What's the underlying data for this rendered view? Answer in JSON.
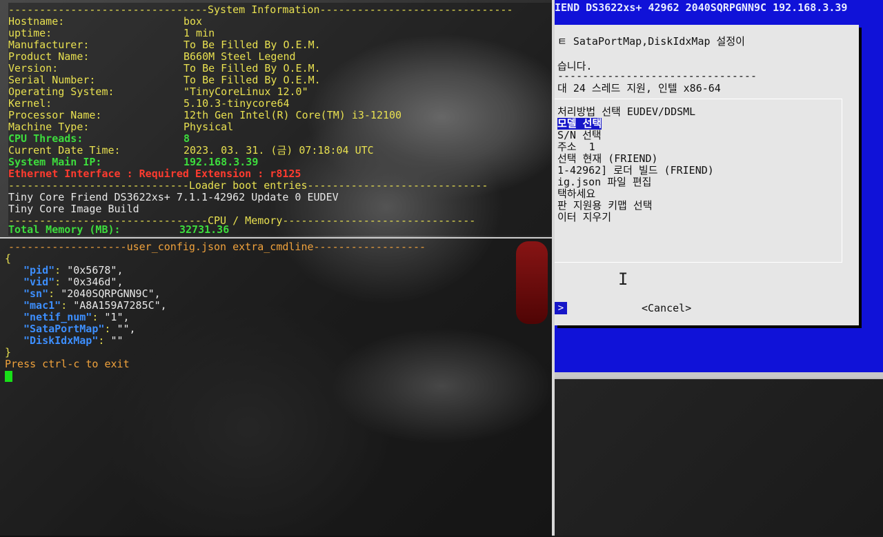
{
  "sysinfo": {
    "header": "--------------------------------System Information-------------------------------",
    "rows": [
      {
        "key": "Hostname:",
        "value": "box"
      },
      {
        "key": "uptime:",
        "value": "1 min"
      },
      {
        "key": "Manufacturer:",
        "value": "To Be Filled By O.E.M."
      },
      {
        "key": "Product Name:",
        "value": "B660M Steel Legend"
      },
      {
        "key": "Version:",
        "value": "To Be Filled By O.E.M."
      },
      {
        "key": "Serial Number:",
        "value": "To Be Filled By O.E.M."
      },
      {
        "key": "Operating System:",
        "value": "\"TinyCoreLinux 12.0\""
      },
      {
        "key": "Kernel:",
        "value": "5.10.3-tinycore64"
      },
      {
        "key": "Processor Name:",
        "value": "12th Gen Intel(R) Core(TM) i3-12100"
      },
      {
        "key": "Machine Type:",
        "value": "Physical"
      }
    ],
    "cpu_threads_key": "CPU Threads:",
    "cpu_threads_value": "8",
    "date_key": "Current Date Time:",
    "date_value": "2023. 03. 31. (금) 07:18:04 UTC",
    "ip_key": "System Main IP:",
    "ip_value": "192.168.3.39",
    "ethernet": "Ethernet Interface : Required Extension : r8125",
    "loader_header": "-----------------------------Loader boot entries-----------------------------",
    "loader_entries": [
      "Tiny Core Friend DS3622xs+ 7.1.1-42962 Update 0 EUDEV",
      "Tiny Core Image Build"
    ],
    "cpu_header": "--------------------------------CPU / Memory-------------------------------",
    "memory_key": "Total Memory (MB):",
    "memory_value": "32731.36"
  },
  "config": {
    "header": "-------------------user_config.json extra_cmdline------------------",
    "open_brace": "{",
    "entries": [
      {
        "key": "\"pid\"",
        "value": "\"0x5678\","
      },
      {
        "key": "\"vid\"",
        "value": "\"0x346d\","
      },
      {
        "key": "\"sn\"",
        "value": "\"2040SQRPGNN9C\","
      },
      {
        "key": "\"mac1\"",
        "value": "\"A8A159A7285C\","
      },
      {
        "key": "\"netif_num\"",
        "value": "\"1\","
      },
      {
        "key": "\"SataPortMap\"",
        "value": "\"\","
      },
      {
        "key": "\"DiskIdxMap\"",
        "value": "\"\""
      }
    ],
    "close_brace": "}",
    "exit_hint": "Press ctrl-c to exit"
  },
  "dialog": {
    "title_bar": "IEND DS3622xs+ 42962 2040SQRPGNN9C 192.168.3.39",
    "lines": [
      "ㅌ SataPortMap,DiskIdxMap 설정이",
      "",
      "습니다.",
      "--------------------------------",
      "대 24 스레드 지원, 인텔 x86-64"
    ],
    "menu": [
      "처리방법 선택 EUDEV/DDSML",
      "모델 선택",
      "S/N 선택",
      "주소  1",
      "선택 현재 (FRIEND)",
      "1-42962] 로더 빌드 (FRIEND)",
      "ig.json 파일 편집",
      "택하세요",
      "판 지원용 키맵 선택",
      "이터 지우기"
    ],
    "ok_label": ">",
    "cancel_label": "<Cancel>"
  },
  "colors": {
    "dialog_bg": "#e6e6e6",
    "dialog_blue": "#1012d8",
    "highlight": "#1616c8",
    "key_yellow": "#e8e050",
    "key_green": "#3ddc3d",
    "error_red": "#ff3b2f",
    "json_key_blue": "#3d8fff"
  }
}
